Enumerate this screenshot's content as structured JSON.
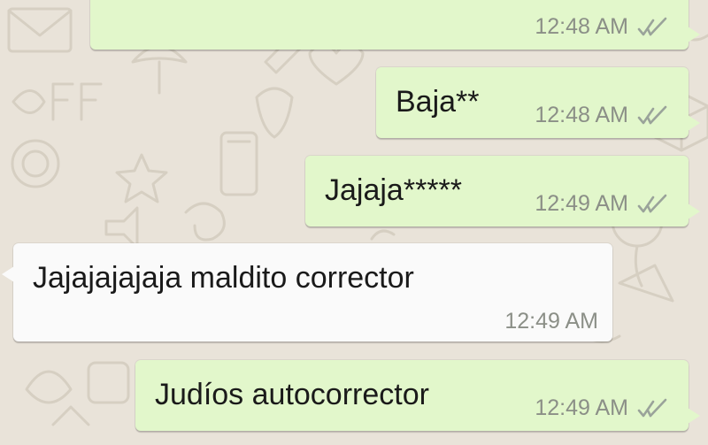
{
  "theme": {
    "background": "#e9e3d9",
    "outgoing_bubble": "#e2f7cb",
    "incoming_bubble": "#fafafa",
    "text": "#1a1a1a",
    "time_text": "#8b8f87",
    "tick_color": "#9aa39a"
  },
  "messages": [
    {
      "direction": "outgoing",
      "text": "",
      "time": "12:48 AM",
      "status_icon": "double-check-icon"
    },
    {
      "direction": "outgoing",
      "text": "Baja**",
      "time": "12:48 AM",
      "status_icon": "double-check-icon"
    },
    {
      "direction": "outgoing",
      "text": "Jajaja*****",
      "time": "12:49 AM",
      "status_icon": "double-check-icon"
    },
    {
      "direction": "incoming",
      "text": "Jajajajajaja maldito corrector",
      "time": "12:49 AM"
    },
    {
      "direction": "outgoing",
      "text": "Judíos autocorrector",
      "time": "12:49 AM",
      "status_icon": "double-check-icon"
    }
  ]
}
